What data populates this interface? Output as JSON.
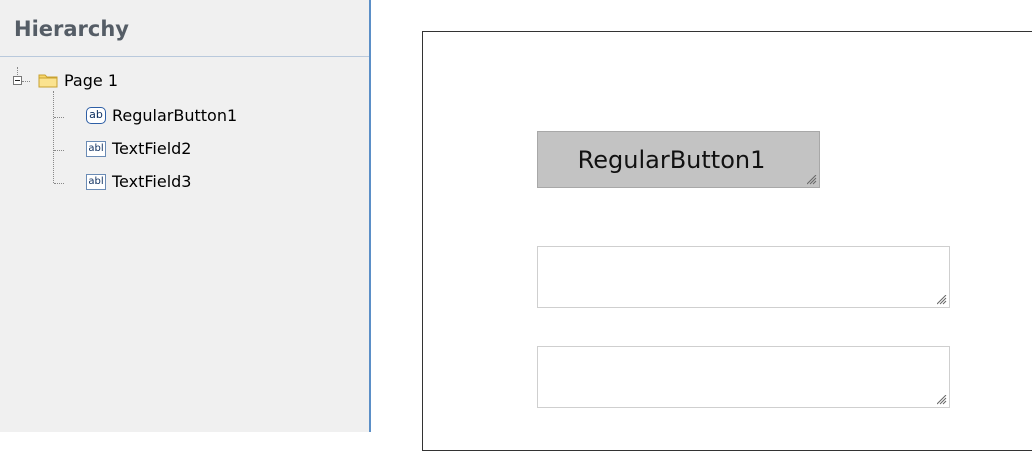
{
  "sidebar": {
    "title": "Hierarchy",
    "tree": {
      "root": {
        "label": "Page 1",
        "icon": "folder-icon",
        "expanded": true
      },
      "children": [
        {
          "label": "RegularButton1",
          "icon": "button-ab-icon",
          "icon_text": "ab"
        },
        {
          "label": "TextField2",
          "icon": "textfield-abl-icon",
          "icon_text": "abl"
        },
        {
          "label": "TextField3",
          "icon": "textfield-abl-icon",
          "icon_text": "abl"
        }
      ]
    }
  },
  "canvas": {
    "button": {
      "label": "RegularButton1"
    },
    "fields": [
      {
        "name": "TextField2",
        "value": ""
      },
      {
        "name": "TextField3",
        "value": ""
      }
    ]
  },
  "colors": {
    "sidebar_bg": "#f0f0f0",
    "sidebar_border": "#5b8fc7",
    "header_text": "#555d66",
    "button_bg": "#c3c3c3"
  }
}
